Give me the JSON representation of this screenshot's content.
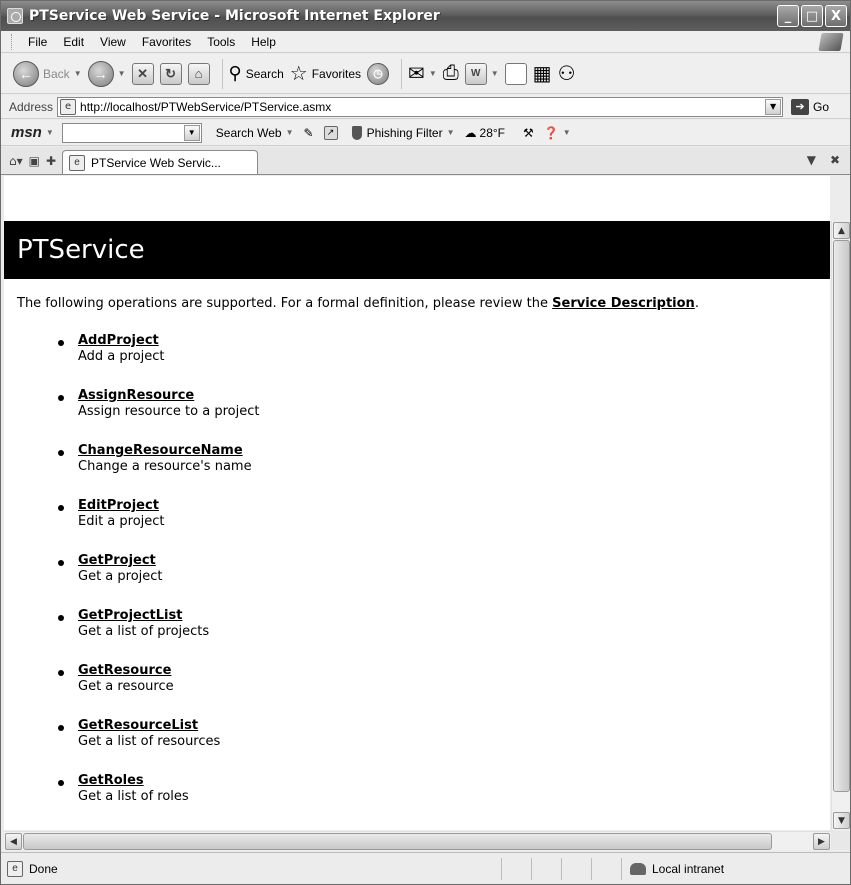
{
  "window": {
    "title": "PTService Web Service - Microsoft Internet Explorer",
    "buttons": {
      "minimize": "_",
      "maximize": "□",
      "close": "X"
    }
  },
  "menu": [
    "File",
    "Edit",
    "View",
    "Favorites",
    "Tools",
    "Help"
  ],
  "toolbar": {
    "back_label": "Back",
    "search_label": "Search",
    "favorites_label": "Favorites"
  },
  "address": {
    "label": "Address",
    "url": "http://localhost/PTWebService/PTService.asmx",
    "go_label": "Go"
  },
  "msn": {
    "logo": "msn",
    "search_web_label": "Search Web",
    "phishing_label": "Phishing Filter",
    "weather": "28°F"
  },
  "tab": {
    "label": "PTService Web Servic..."
  },
  "page": {
    "title": "PTService",
    "intro_text": "The following operations are supported. For a formal definition, please review the",
    "intro_link": "Service Description",
    "intro_end": ".",
    "operations": [
      {
        "name": "AddProject",
        "description": "Add a project"
      },
      {
        "name": "AssignResource",
        "description": "Assign resource to a project"
      },
      {
        "name": "ChangeResourceName",
        "description": "Change a resource's name"
      },
      {
        "name": "EditProject",
        "description": "Edit a project"
      },
      {
        "name": "GetProject",
        "description": "Get a project"
      },
      {
        "name": "GetProjectList",
        "description": "Get a list of projects"
      },
      {
        "name": "GetResource",
        "description": "Get a resource"
      },
      {
        "name": "GetResourceList",
        "description": "Get a list of resources"
      },
      {
        "name": "GetRoles",
        "description": "Get a list of roles"
      }
    ]
  },
  "status": {
    "text": "Done",
    "zone": "Local intranet"
  }
}
